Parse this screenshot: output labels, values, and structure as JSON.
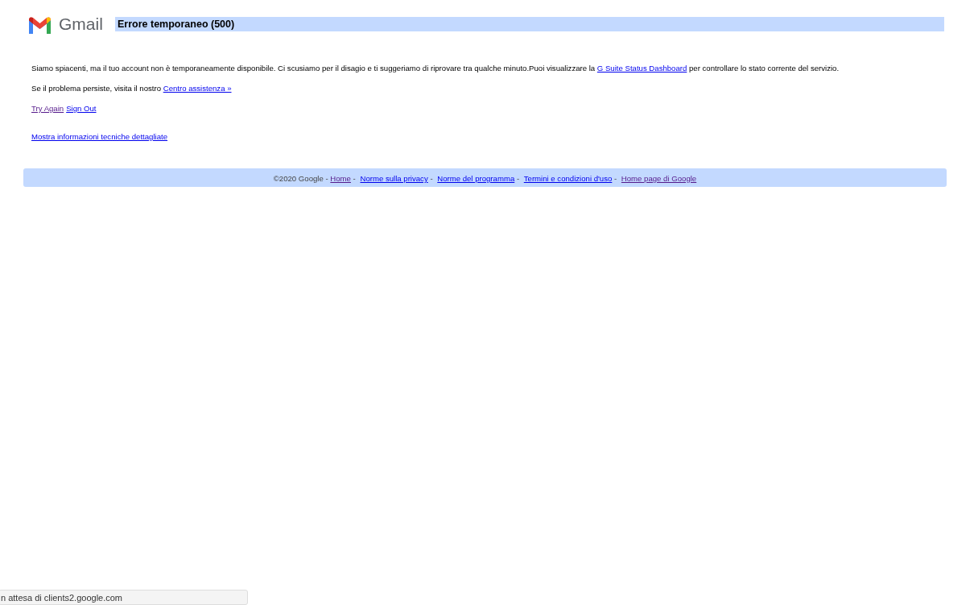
{
  "header": {
    "logo_text": "Gmail",
    "title": "Errore temporaneo (500)"
  },
  "paragraphs": [
    {
      "parts": [
        {
          "kind": "text",
          "text": "Siamo spiacenti, ma il tuo account non è temporaneamente disponibile. Ci scusiamo per il disagio e ti suggeriamo di riprovare tra qualche minuto.Puoi visualizzare la "
        },
        {
          "kind": "link",
          "text": "G Suite Status Dashboard",
          "visited": false
        },
        {
          "kind": "text",
          "text": " per controllare lo stato corrente del servizio."
        }
      ]
    },
    {
      "parts": [
        {
          "kind": "text",
          "text": "Se il problema persiste, visita il nostro "
        },
        {
          "kind": "link",
          "text": "Centro assistenza »",
          "visited": false
        }
      ]
    },
    {
      "parts": [
        {
          "kind": "link",
          "text": "Try Again",
          "visited": true
        },
        {
          "kind": "link",
          "text": "Sign Out",
          "visited": false
        }
      ]
    },
    {
      "parts": [
        {
          "kind": "link",
          "text": "Mostra informazioni tecniche dettagliate",
          "visited": false
        }
      ]
    }
  ],
  "footer": {
    "parts": [
      {
        "kind": "text",
        "text": "©2020 Google - "
      },
      {
        "kind": "link",
        "text": "Home",
        "visited": true
      },
      {
        "kind": "text",
        "text": " - "
      },
      {
        "kind": "link",
        "text": "Norme sulla privacy",
        "visited": false
      },
      {
        "kind": "text",
        "text": " - "
      },
      {
        "kind": "link",
        "text": "Norme del programma",
        "visited": false
      },
      {
        "kind": "text",
        "text": " - "
      },
      {
        "kind": "link",
        "text": "Termini e condizioni d'uso",
        "visited": false
      },
      {
        "kind": "text",
        "text": " - "
      },
      {
        "kind": "link",
        "text": "Home page di Google",
        "visited": true
      }
    ]
  },
  "status_bar": {
    "text": "n attesa di clients2.google.com"
  }
}
